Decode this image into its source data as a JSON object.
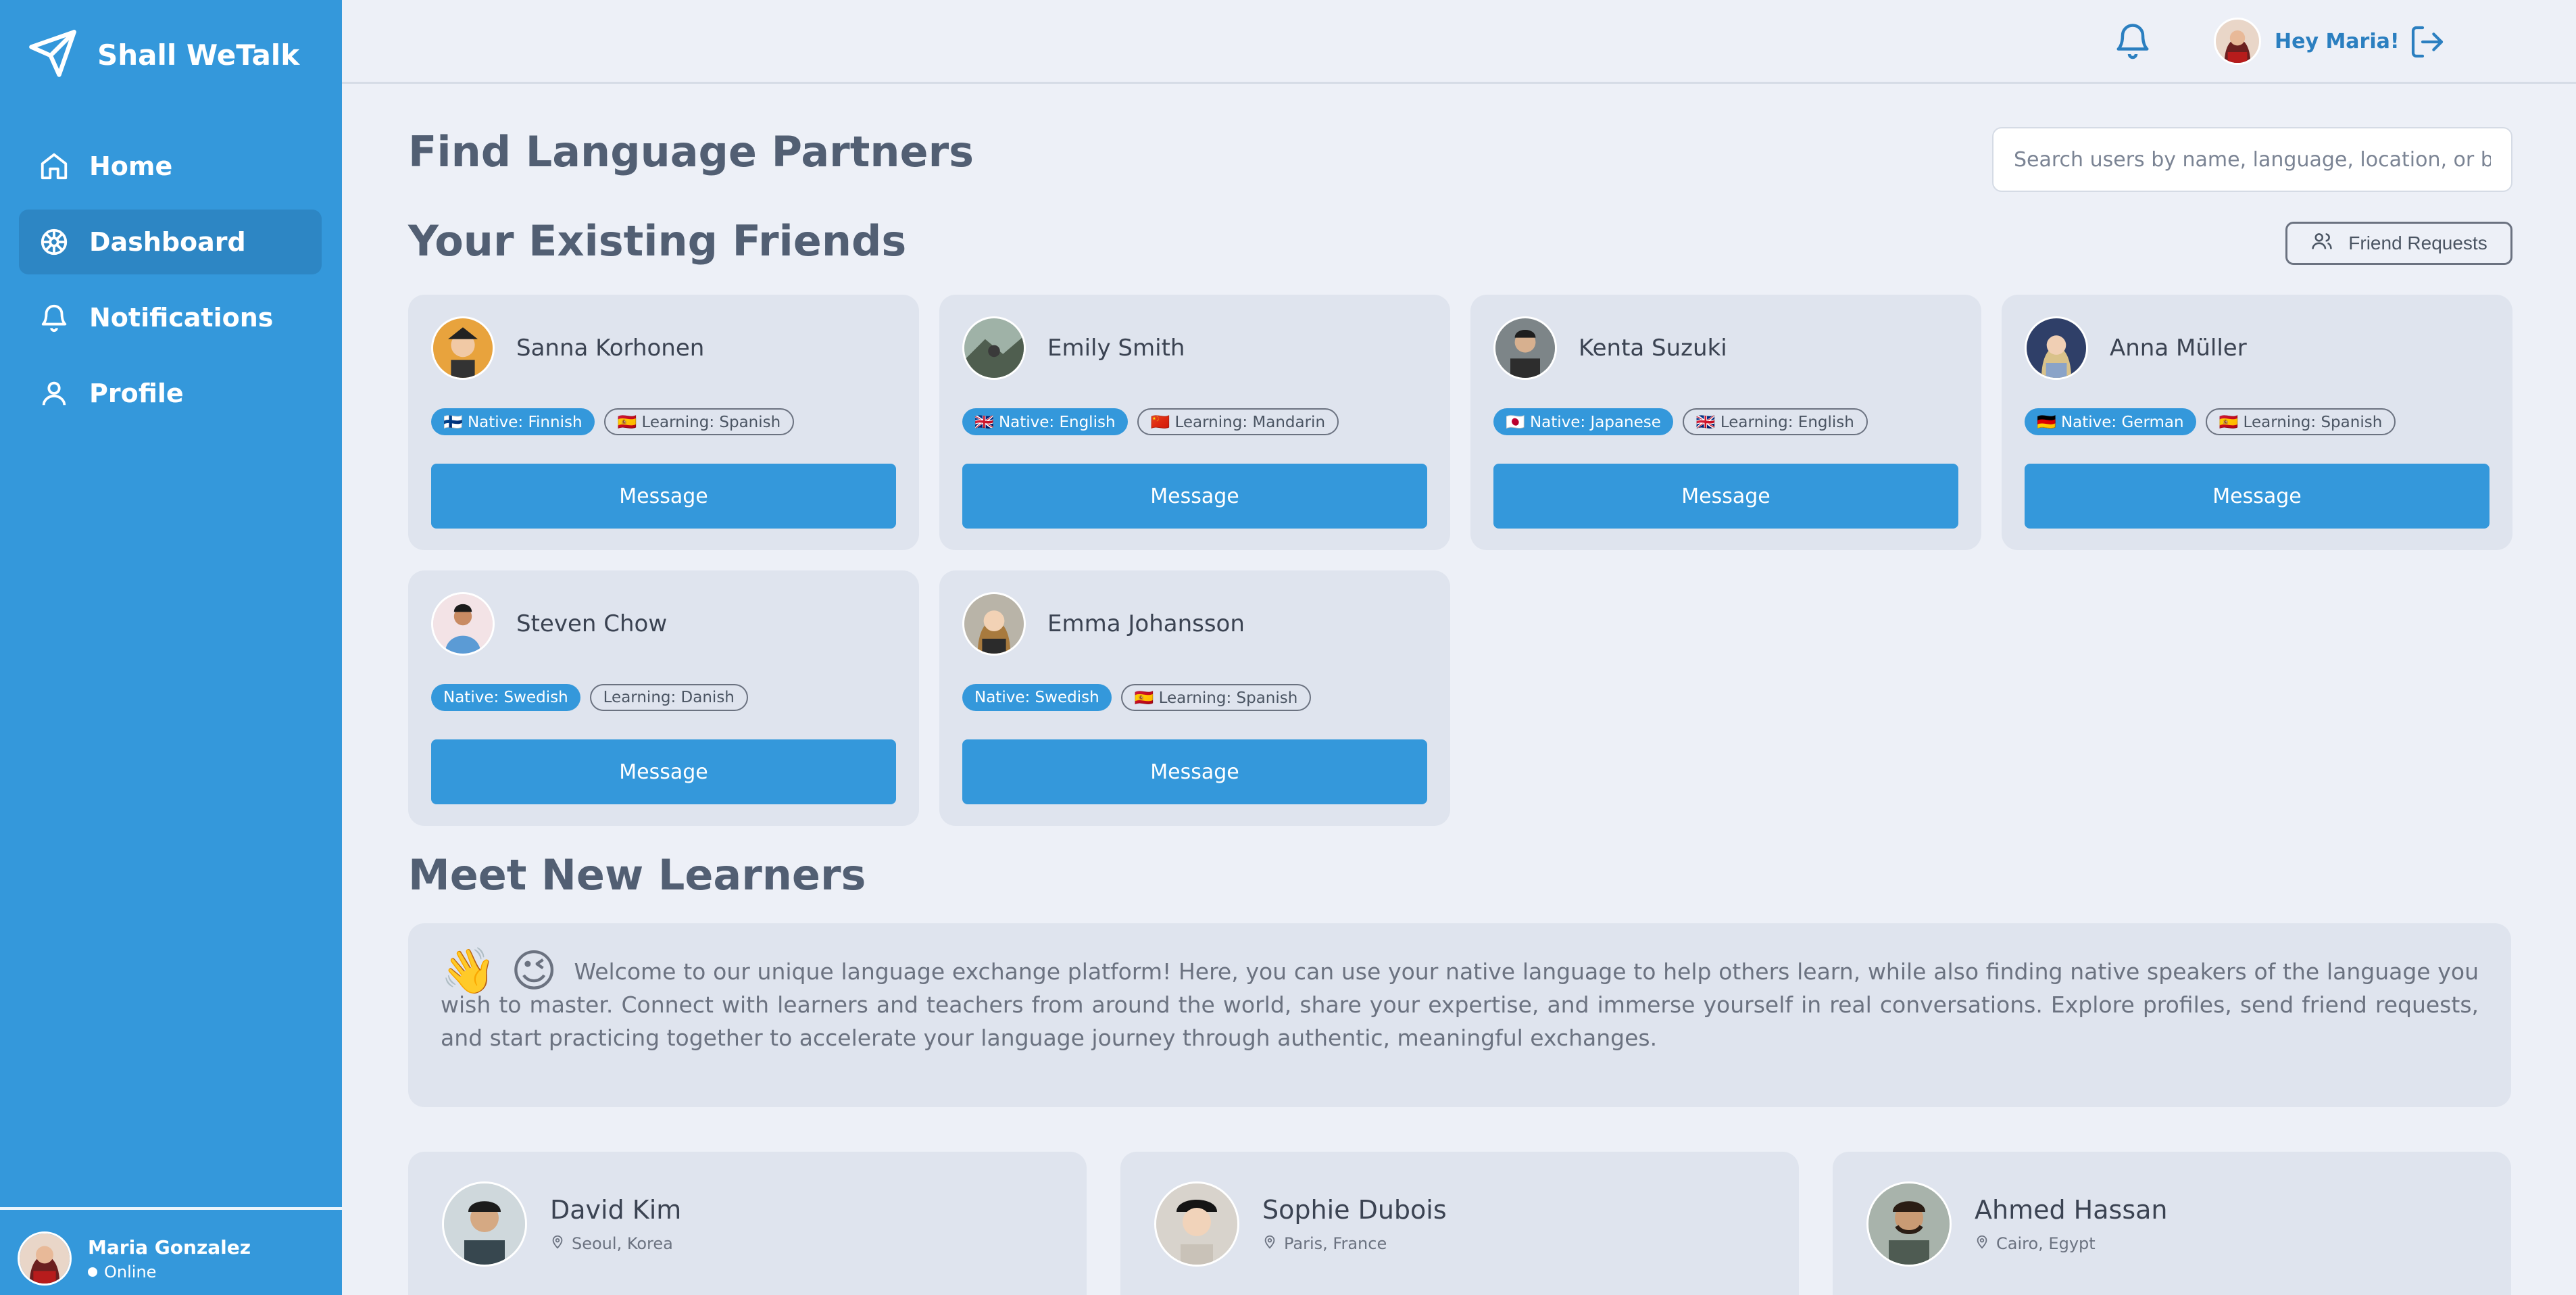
{
  "app": {
    "name": "Shall WeTalk"
  },
  "sidebar": {
    "items": [
      {
        "label": "Home",
        "icon": "home-icon"
      },
      {
        "label": "Dashboard",
        "icon": "dashboard-icon",
        "active": true
      },
      {
        "label": "Notifications",
        "icon": "bell-icon"
      },
      {
        "label": "Profile",
        "icon": "user-icon"
      }
    ],
    "user": {
      "name": "Maria Gonzalez",
      "status": "Online"
    }
  },
  "topbar": {
    "greeting": "Hey Maria!"
  },
  "main": {
    "page_title": "Find Language Partners",
    "search_placeholder": "Search users by name, language, location, or bio...",
    "friends_title": "Your Existing Friends",
    "friend_requests_label": "Friend Requests",
    "friends": [
      {
        "name": "Sanna Korhonen",
        "native": "🇫🇮 Native: Finnish",
        "learning": "🇪🇸 Learning: Spanish",
        "button": "Message"
      },
      {
        "name": "Emily Smith",
        "native": "🇬🇧 Native: English",
        "learning": "🇨🇳 Learning: Mandarin",
        "button": "Message"
      },
      {
        "name": "Kenta Suzuki",
        "native": "🇯🇵 Native: Japanese",
        "learning": "🇬🇧 Learning: English",
        "button": "Message"
      },
      {
        "name": "Anna Müller",
        "native": "🇩🇪 Native: German",
        "learning": "🇪🇸 Learning: Spanish",
        "button": "Message"
      },
      {
        "name": "Steven Chow",
        "native": "Native: Swedish",
        "learning": "Learning: Danish",
        "button": "Message"
      },
      {
        "name": "Emma Johansson",
        "native": "Native: Swedish",
        "learning": "🇪🇸 Learning: Spanish",
        "button": "Message"
      }
    ],
    "learners_title": "Meet New Learners",
    "welcome": {
      "emojis": "👋 😉",
      "text": "Welcome to our unique language exchange platform! Here, you can use your native language to help others learn, while also finding native speakers of the language you wish to master. Connect with learners and teachers from around the world, share your expertise, and immerse yourself in real conversations. Explore profiles, send friend requests, and start practicing together to accelerate your language journey through authentic, meaningful exchanges."
    },
    "learners": [
      {
        "name": "David Kim",
        "location": "Seoul, Korea"
      },
      {
        "name": "Sophie Dubois",
        "location": "Paris, France"
      },
      {
        "name": "Ahmed Hassan",
        "location": "Cairo, Egypt"
      }
    ]
  },
  "colors": {
    "primary": "#3498db",
    "sidebar_active": "#2d86c4",
    "background": "#edf0f7",
    "card": "#dfe4ee"
  }
}
